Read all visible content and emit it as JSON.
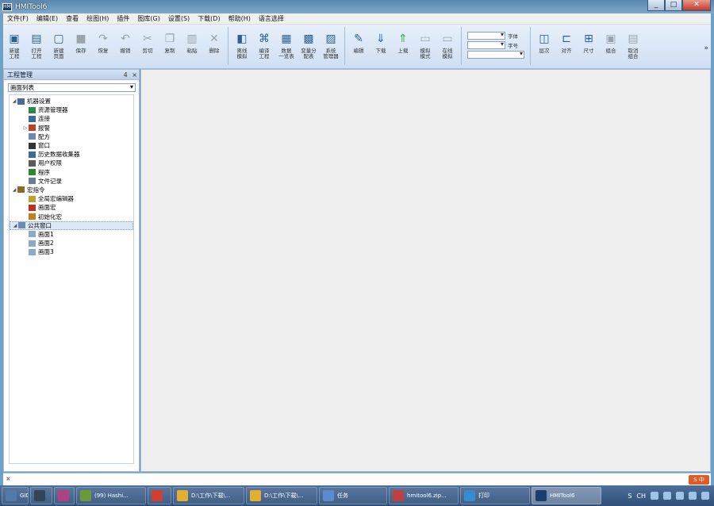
{
  "window": {
    "title": "HMITool6",
    "icon": "app-icon",
    "controls": [
      "_",
      "□",
      "✕"
    ]
  },
  "menu": [
    "文件(F)",
    "编辑(E)",
    "查看",
    "绘图(H)",
    "插件",
    "图库(G)",
    "设置(S)",
    "下载(D)",
    "帮助(H)",
    "语言选择"
  ],
  "toolbar": {
    "group1": [
      {
        "label": "新建\n工程",
        "icon": "new-project-icon"
      },
      {
        "label": "打开\n工程",
        "icon": "open-project-icon"
      },
      {
        "label": "新建\n页面",
        "icon": "new-page-icon"
      },
      {
        "label": "保存",
        "icon": "save-icon"
      },
      {
        "label": "恢复",
        "icon": "redo-icon"
      },
      {
        "label": "撤销",
        "icon": "undo-icon"
      },
      {
        "label": "剪切",
        "icon": "cut-icon"
      },
      {
        "label": "复制",
        "icon": "copy-icon"
      },
      {
        "label": "粘贴",
        "icon": "paste-icon"
      },
      {
        "label": "删除",
        "icon": "delete-icon"
      }
    ],
    "group2": [
      {
        "label": "离线\n模拟",
        "icon": "simulate-icon"
      },
      {
        "label": "编译\n工程",
        "icon": "compile-icon"
      },
      {
        "label": "数据\n一览表",
        "icon": "data-table-icon"
      },
      {
        "label": "变量分\n配表",
        "icon": "var-table-icon"
      },
      {
        "label": "系统\n管理器",
        "icon": "system-manager-icon"
      }
    ],
    "group3": [
      {
        "label": "编辑",
        "icon": "edit-icon"
      },
      {
        "label": "下载",
        "icon": "download-icon"
      },
      {
        "label": "上载",
        "icon": "upload-icon"
      },
      {
        "label": "模拟\n模式",
        "icon": "sim-mode-icon"
      },
      {
        "label": "在线\n模拟",
        "icon": "online-sim-icon"
      }
    ],
    "combos": [
      {
        "value": "",
        "label": "字体"
      },
      {
        "value": "",
        "label": "字号"
      },
      {
        "value": "",
        "label": ""
      }
    ],
    "group4": [
      {
        "label": "层次",
        "icon": "layer-icon"
      },
      {
        "label": "对齐",
        "icon": "align-icon"
      },
      {
        "label": "尺寸",
        "icon": "size-icon"
      },
      {
        "label": "组合",
        "icon": "group-icon"
      },
      {
        "label": "取消\n组合",
        "icon": "ungroup-icon"
      }
    ],
    "more": "»"
  },
  "panel": {
    "title": "工程管理",
    "pin": "4",
    "close": "×",
    "selector": "画面列表",
    "tree": [
      {
        "label": "机器设置",
        "level": 0,
        "expander": "◢",
        "color": "#4a6a9a"
      },
      {
        "label": "资源管理器",
        "level": 1,
        "expander": "",
        "color": "#2a8a4a"
      },
      {
        "label": "连接",
        "level": 1,
        "expander": "",
        "color": "#3a6aa0"
      },
      {
        "label": "报警",
        "level": 1,
        "expander": "▷",
        "color": "#c04020"
      },
      {
        "label": "配方",
        "level": 1,
        "expander": "",
        "color": "#6a8ab0"
      },
      {
        "label": "窗口",
        "level": 1,
        "expander": "",
        "color": "#333333"
      },
      {
        "label": "历史数据收集器",
        "level": 1,
        "expander": "",
        "color": "#3a6aa0"
      },
      {
        "label": "用户权限",
        "level": 1,
        "expander": "",
        "color": "#5a5a5a"
      },
      {
        "label": "程序",
        "level": 1,
        "expander": "",
        "color": "#2a8a2a"
      },
      {
        "label": "文件记录",
        "level": 1,
        "expander": "",
        "color": "#6a7a9a"
      },
      {
        "label": "宏指令",
        "level": 0,
        "expander": "◢",
        "color": "#8a6a2a"
      },
      {
        "label": "全局宏编辑器",
        "level": 1,
        "expander": "",
        "color": "#c0a030"
      },
      {
        "label": "画面宏",
        "level": 1,
        "expander": "",
        "color": "#c03020"
      },
      {
        "label": "初始化宏",
        "level": 1,
        "expander": "",
        "color": "#c08020"
      },
      {
        "label": "公共窗口",
        "level": 0,
        "expander": "◢",
        "color": "#6a8ab0",
        "selected": true
      },
      {
        "label": "画面1",
        "level": 1,
        "expander": "",
        "color": "#8aaacc"
      },
      {
        "label": "画面2",
        "level": 1,
        "expander": "",
        "color": "#8aaacc"
      },
      {
        "label": "画面3",
        "level": 1,
        "expander": "",
        "color": "#8aaacc"
      }
    ]
  },
  "bottom": {
    "close": "×",
    "ime": "S 中"
  },
  "taskbar": {
    "items": [
      {
        "label": "GID...",
        "color": "#5577aa"
      },
      {
        "label": "",
        "color": "#334455"
      },
      {
        "label": "",
        "color": "#b04080"
      },
      {
        "label": "(99) Hashi...",
        "color": "#6a9a3a"
      },
      {
        "label": "",
        "color": "#d04030"
      },
      {
        "label": "D:\\工作\\下载\\...",
        "color": "#e0b030"
      },
      {
        "label": "D:\\工作\\下载\\...",
        "color": "#e0b030"
      },
      {
        "label": "任务",
        "color": "#5a8ad0"
      },
      {
        "label": "hmitool6.zip...",
        "color": "#c04040"
      },
      {
        "label": "打印",
        "color": "#3a8ad0"
      },
      {
        "label": "HMITool6",
        "color": "#1c3e6a",
        "active": true
      }
    ],
    "tray": [
      "S",
      "CH"
    ]
  }
}
